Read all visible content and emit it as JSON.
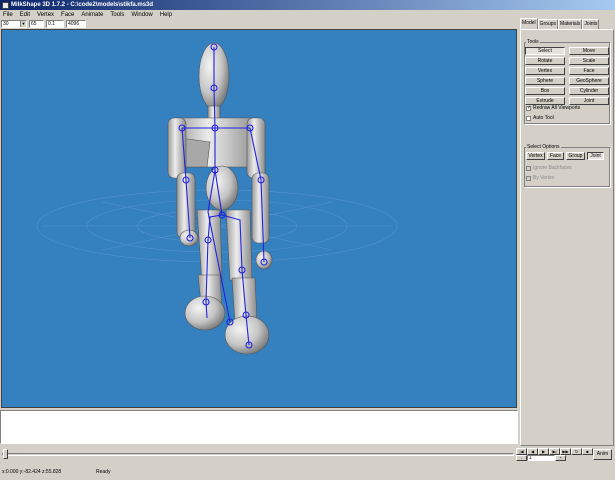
{
  "window": {
    "title": "MilkShape 3D 1.7.2 - C:\\code2\\models\\stikfa.ms3d"
  },
  "menu": [
    "File",
    "Edit",
    "Vertex",
    "Face",
    "Animate",
    "Tools",
    "Window",
    "Help"
  ],
  "toolbar": {
    "zoom": "30",
    "field2": "65",
    "field3": "0.1",
    "field4": "4096"
  },
  "tabs": [
    "Model",
    "Groups",
    "Materials",
    "Joints"
  ],
  "tools": {
    "label": "Tools",
    "buttons": [
      "Select",
      "Move",
      "Rotate",
      "Scale",
      "Vertex",
      "Face",
      "Sphere",
      "GeoSphere",
      "Box",
      "Cylinder",
      "Extrude",
      "Joint"
    ],
    "pressed": "Select"
  },
  "options": {
    "redraw": "Redraw All Viewports",
    "auto_tool": "Auto Tool",
    "redraw_checked": true,
    "auto_checked": false
  },
  "select_options": {
    "label": "Select Options",
    "buttons": [
      "Vertex",
      "Face",
      "Group",
      "Joint"
    ],
    "pressed": "Joint",
    "ignore_backfaces": "Ignore Backfaces",
    "by_vertex": "By Vertex"
  },
  "timeline": {
    "frame": "1",
    "anim_label": "Anim"
  },
  "status": {
    "coords": "x:0.000 y:-82.424 z:55.828",
    "message": "Ready"
  },
  "colors": {
    "viewport": "#3580bf",
    "bones": "#2222dd",
    "mesh": "#c8c8c8"
  }
}
